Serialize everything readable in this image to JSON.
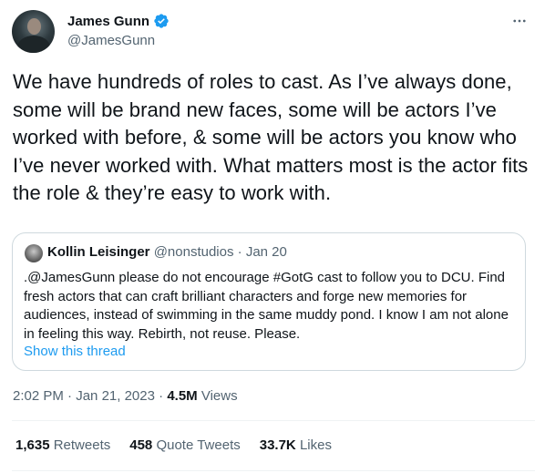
{
  "author": {
    "display_name": "James Gunn",
    "handle": "@JamesGunn",
    "avatar_icon": "avatar-photo",
    "verified_icon": "verified-badge-icon",
    "verified_color": "#1d9bf0"
  },
  "tweet": {
    "text": "We have hundreds of roles to cast. As I’ve always done, some will be brand new faces, some will be actors I’ve worked with before, & some will be actors you know who I’ve never worked with. What matters most is the actor fits the role & they’re easy to work with."
  },
  "quote": {
    "name": "Kollin Leisinger",
    "handle": "@nonstudios",
    "separator": "·",
    "date": "Jan 20",
    "text": ".@JamesGunn please do not encourage #GotG cast to follow you to DCU. Find fresh actors that can craft brilliant characters and forge new memories for audiences, instead of swimming in the same muddy pond. I know I am not alone in feeling this way. Rebirth, not reuse. Please.",
    "show_thread": "Show this thread"
  },
  "meta": {
    "time": "2:02 PM",
    "separator": "·",
    "date": "Jan 21, 2023",
    "views_count": "4.5M",
    "views_label": "Views"
  },
  "stats": {
    "retweets_count": "1,635",
    "retweets_label": "Retweets",
    "quotes_count": "458",
    "quotes_label": "Quote Tweets",
    "likes_count": "33.7K",
    "likes_label": "Likes"
  },
  "colors": {
    "link": "#1d9bf0",
    "secondary_text": "#536471",
    "border": "#cfd9de"
  }
}
